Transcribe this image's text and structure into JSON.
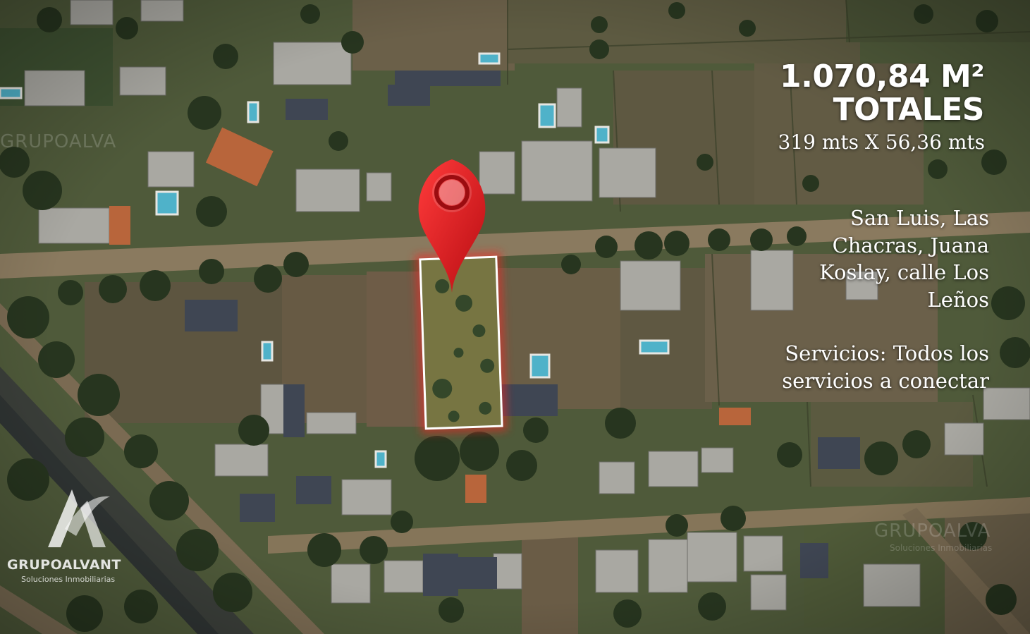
{
  "listing": {
    "area_line1": "1.070,84 M²",
    "area_line2": "TOTALES",
    "dimensions": "319 mts X 56,36 mts",
    "location": "San Luis, Las Chacras, Juana Koslay, calle Los Leños",
    "services": "Servicios: Todos los servicios a conectar"
  },
  "brand": {
    "name": "GRUPOALVANT",
    "tagline": "Soluciones Inmobiliarias"
  },
  "watermarks": {
    "top_left": "GRUPOALVA",
    "bottom_right_name": "GRUPOALVA",
    "bottom_right_tagline": "Soluciones Inmobiliarias"
  },
  "icons": {
    "pin": "map-pin-icon",
    "logo": "grupoalvant-logo-icon"
  },
  "colors": {
    "pin": "#e0161b",
    "lot_outline": "#ffffff",
    "lot_glow": "#ff2020",
    "text": "#ffffff"
  }
}
